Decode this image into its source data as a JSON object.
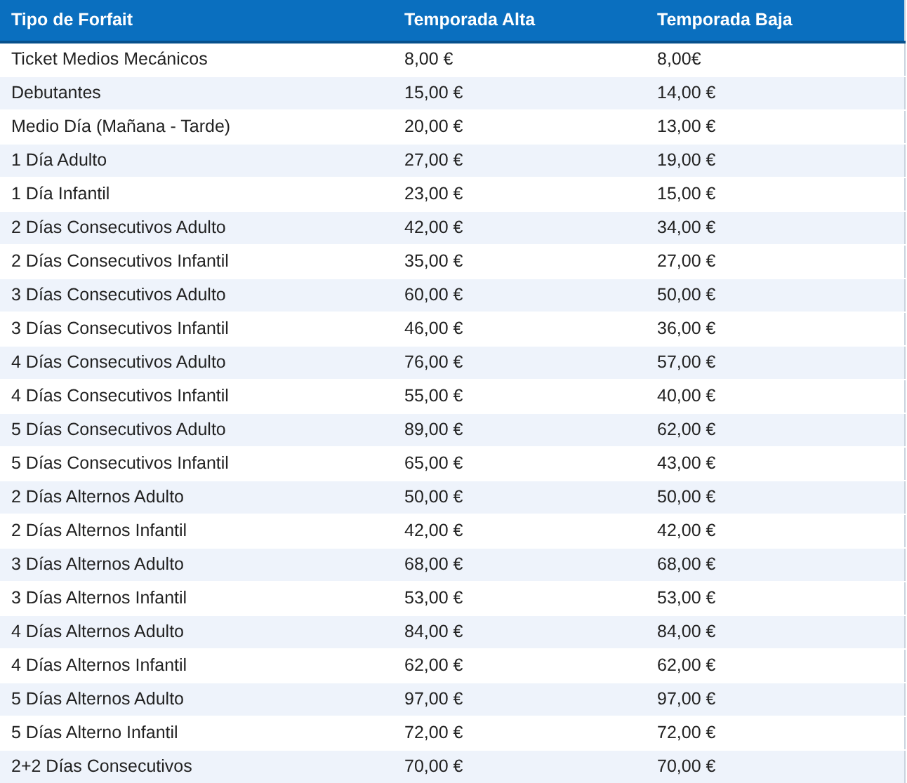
{
  "table": {
    "columns": [
      "Tipo de Forfait",
      "Temporada Alta",
      "Temporada Baja"
    ],
    "rows": [
      [
        "Ticket Medios Mecánicos",
        "8,00 €",
        "8,00€"
      ],
      [
        "Debutantes",
        "15,00 €",
        "14,00 €"
      ],
      [
        "Medio Día (Mañana - Tarde)",
        "20,00 €",
        "13,00 €"
      ],
      [
        "1 Día Adulto",
        "27,00 €",
        "19,00 €"
      ],
      [
        "1 Día Infantil",
        "23,00 €",
        "15,00 €"
      ],
      [
        "2 Días Consecutivos Adulto",
        "42,00 €",
        "34,00 €"
      ],
      [
        "2 Días Consecutivos Infantil",
        "35,00 €",
        "27,00 €"
      ],
      [
        "3 Días Consecutivos Adulto",
        "60,00 €",
        "50,00 €"
      ],
      [
        "3 Días Consecutivos Infantil",
        "46,00 €",
        "36,00 €"
      ],
      [
        "4 Días Consecutivos Adulto",
        "76,00 €",
        "57,00 €"
      ],
      [
        "4 Días Consecutivos Infantil",
        "55,00 €",
        "40,00 €"
      ],
      [
        "5 Días Consecutivos Adulto",
        "89,00 €",
        "62,00 €"
      ],
      [
        "5 Días Consecutivos Infantil",
        "65,00 €",
        "43,00 €"
      ],
      [
        "2 Días Alternos Adulto",
        "50,00 €",
        "50,00 €"
      ],
      [
        "2 Días Alternos Infantil",
        "42,00 €",
        "42,00 €"
      ],
      [
        "3 Días Alternos Adulto",
        "68,00 €",
        "68,00 €"
      ],
      [
        "3 Días Alternos Infantil",
        "53,00 €",
        "53,00 €"
      ],
      [
        "4 Días Alternos Adulto",
        "84,00 €",
        "84,00 €"
      ],
      [
        "4 Días Alternos Infantil",
        "62,00 €",
        "62,00 €"
      ],
      [
        "5 Días Alternos Adulto",
        "97,00 €",
        "97,00 €"
      ],
      [
        "5 Días Alterno Infantil",
        "72,00 €",
        "72,00 €"
      ],
      [
        "2+2 Días Consecutivos",
        "70,00 €",
        "70,00 €"
      ]
    ]
  }
}
